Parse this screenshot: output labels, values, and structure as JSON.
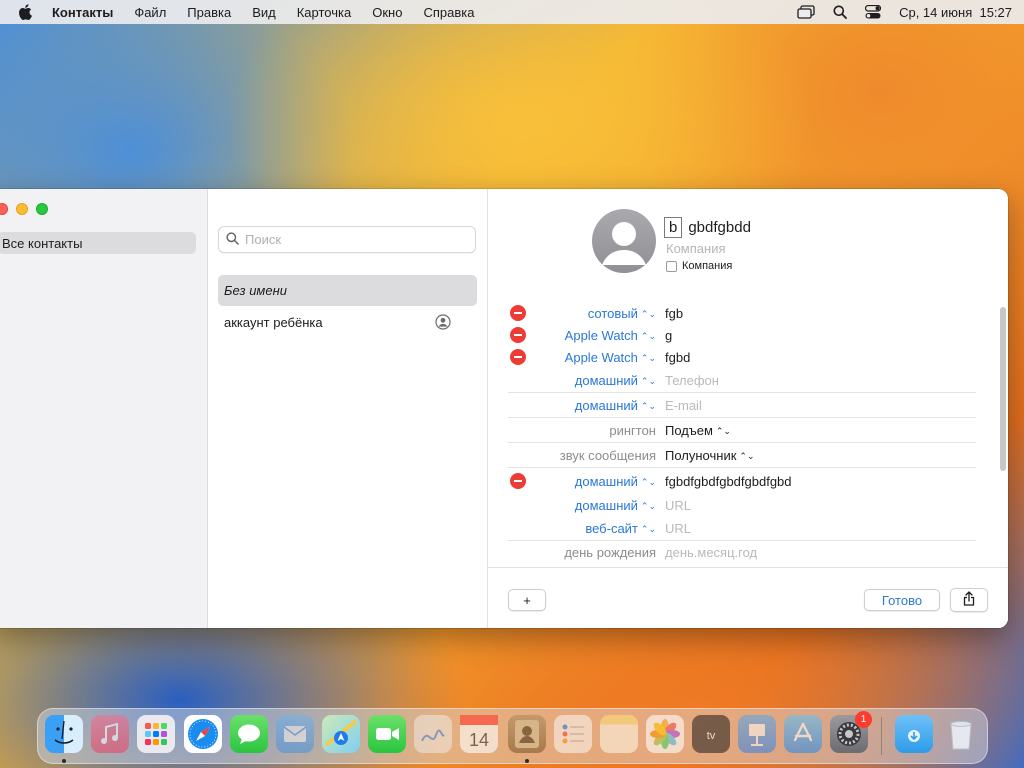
{
  "menubar": {
    "app_name": "Контакты",
    "items": [
      "Файл",
      "Правка",
      "Вид",
      "Карточка",
      "Окно",
      "Справка"
    ],
    "datetime": "Ср, 14 июня  15:27"
  },
  "sidebar": {
    "items": [
      {
        "label": "Все контакты"
      }
    ]
  },
  "list": {
    "search_placeholder": "Поиск",
    "items": [
      {
        "label": "Без имени"
      },
      {
        "label": "аккаунт ребёнка"
      }
    ]
  },
  "detail": {
    "first_name": "b",
    "last_name": "gbdfgbdd",
    "company_placeholder": "Компания",
    "company_checkbox_label": "Компания",
    "fields": [
      {
        "label": "сотовый",
        "value": "fgb",
        "removable": true
      },
      {
        "label": "Apple Watch",
        "value": "g",
        "removable": true
      },
      {
        "label": "Apple Watch",
        "value": "fgbd",
        "removable": true
      },
      {
        "label": "домашний",
        "value": "Телефон",
        "placeholder": true
      },
      {
        "label": "домашний",
        "value": "E-mail",
        "placeholder": true
      },
      {
        "label": "рингтон",
        "value": "Подъем"
      },
      {
        "label": "звук сообщения",
        "value": "Полуночник"
      },
      {
        "label": "домашний",
        "value": "fgbdfgbdfgbdfgbdfgbd",
        "removable": true
      },
      {
        "label": "домашний",
        "value": "URL",
        "placeholder": true
      },
      {
        "label": "веб-сайт",
        "value": "URL",
        "placeholder": true
      },
      {
        "label": "день рождения",
        "value": "день.месяц.год",
        "placeholder": true
      }
    ],
    "buttons": {
      "add": "+",
      "done": "Готово"
    }
  },
  "dock": {
    "apps": [
      "Finder",
      "Music",
      "Launchpad",
      "Safari",
      "Messages",
      "Mail",
      "Maps",
      "FaceTime",
      "Freeform",
      "Calendar",
      "Contacts",
      "Reminders",
      "Notes",
      "Photos",
      "TV",
      "Keynote",
      "App Store",
      "System Settings",
      "Downloads",
      "Trash"
    ],
    "calendar_day": "14",
    "settings_badge": "1"
  }
}
